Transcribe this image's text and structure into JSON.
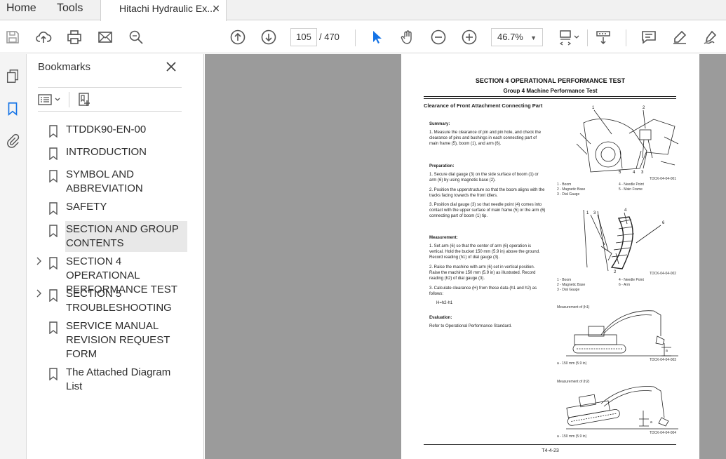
{
  "tabs": {
    "home": "Home",
    "tools": "Tools",
    "document": "Hitachi Hydraulic Ex...",
    "close_glyph": "✕"
  },
  "toolbar": {
    "page_current": "105",
    "page_total": "/ 470",
    "zoom": "46.7%"
  },
  "bookmarks": {
    "title": "Bookmarks",
    "items": [
      {
        "label": "TTDDK90-EN-00",
        "expandable": false,
        "selected": false
      },
      {
        "label": "INTRODUCTION",
        "expandable": false,
        "selected": false
      },
      {
        "label": "SYMBOL AND ABBREVIATION",
        "expandable": false,
        "selected": false
      },
      {
        "label": "SAFETY",
        "expandable": false,
        "selected": false
      },
      {
        "label": "SECTION AND GROUP CONTENTS",
        "expandable": false,
        "selected": true
      },
      {
        "label": "SECTION 4 OPERATIONAL PERFORMANCE TEST",
        "expandable": true,
        "selected": false
      },
      {
        "label": "SECTION 5 TROUBLESHOOTING",
        "expandable": true,
        "selected": false
      },
      {
        "label": "SERVICE MANUAL REVISION REQUEST FORM",
        "expandable": false,
        "selected": false
      },
      {
        "label": "The Attached Diagram List",
        "expandable": false,
        "selected": false
      }
    ]
  },
  "document_page": {
    "section_title": "SECTION 4 OPERATIONAL PERFORMANCE TEST",
    "group_title": "Group 4 Machine Performance Test",
    "heading": "Clearance of Front Attachment Connecting Part",
    "summary_label": "Summary:",
    "summary_1": "1. Measure the clearance of pin and pin hole, and check the clearance of pins and bushings in each connecting part of main frame (5), boom (1), and arm (6).",
    "preparation_label": "Preparation:",
    "prep_1": "1. Secure dial gauge (3) on the side surface of boom (1) or arm (6) by using magnetic base (2).",
    "prep_2": "2. Position the upperstructure so that the boom aligns with the tracks facing towards the front idlers.",
    "prep_3": "3. Position dial gauge (3) so that needle point (4) comes into contact with the upper surface of main frame (5) or the arm (6) connecting part of boom (1) tip.",
    "measurement_label": "Measurement:",
    "meas_1": "1. Set arm (6) so that the center of arm (6) operation is vertical. Hold the bucket 150 mm (5.9 in) above the ground. Record reading (h1) of dial gauge (3).",
    "meas_2": "2. Raise the machine with arm (6) set in vertical position. Raise the machine 150 mm (5.9 in) as illustrated. Record reading (h2) of dial gauge (3).",
    "meas_3": "3. Calculate clearance (H) from these data (h1 and h2) as follows:",
    "formula": "H=h2-h1",
    "evaluation_label": "Evaluation:",
    "evaluation_text": "Refer to Operational Performance Standard.",
    "fig1_id": "TDCK-04-04-001",
    "fig1_cap_left": "1 - Boom\n2 - Magnetic Base\n3 - Dial Gauge",
    "fig1_cap_right": "4 - Needle Point\n5 - Main Frame",
    "fig2_id": "TDCK-04-04-002",
    "fig2_cap_left": "1 - Boom\n2 - Magnetic Base\n3 - Dial Gauge",
    "fig2_cap_right": "4 - Needle Point\n6 - Arm",
    "fig3_title": "Measurement of (h1)",
    "fig3_id": "TDCK-04-04-003",
    "fig3_cap": "a - 150 mm (5.9 in)",
    "fig4_title": "Measurement of (h2)",
    "fig4_id": "TDCK-04-04-004",
    "fig4_cap": "a - 150 mm (5.9 in)",
    "footer": "T4-4-23"
  }
}
